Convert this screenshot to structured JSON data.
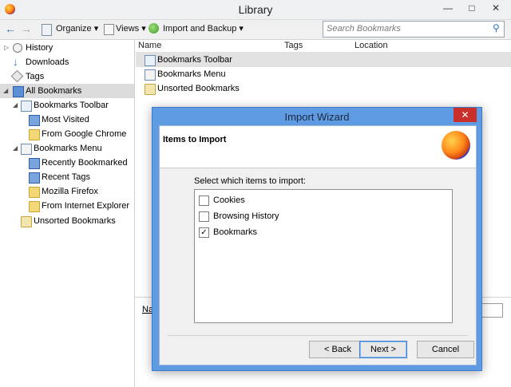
{
  "window": {
    "title": "Library"
  },
  "toolbar": {
    "organize_label": "Organize",
    "views_label": "Views",
    "import_label": "Import and Backup",
    "search_placeholder": "Search Bookmarks"
  },
  "sidebar": {
    "items": [
      {
        "label": "History"
      },
      {
        "label": "Downloads"
      },
      {
        "label": "Tags"
      },
      {
        "label": "All Bookmarks"
      },
      {
        "label": "Bookmarks Toolbar"
      },
      {
        "label": "Most Visited"
      },
      {
        "label": "From Google Chrome"
      },
      {
        "label": "Bookmarks Menu"
      },
      {
        "label": "Recently Bookmarked"
      },
      {
        "label": "Recent Tags"
      },
      {
        "label": "Mozilla Firefox"
      },
      {
        "label": "From Internet Explorer"
      },
      {
        "label": "Unsorted Bookmarks"
      }
    ]
  },
  "content": {
    "columns": [
      "Name",
      "Tags",
      "Location"
    ],
    "rows": [
      {
        "name": "Bookmarks Toolbar"
      },
      {
        "name": "Bookmarks Menu"
      },
      {
        "name": "Unsorted Bookmarks"
      }
    ],
    "name_field_label": "Na"
  },
  "dialog": {
    "title": "Import Wizard",
    "close_label": "✕",
    "heading": "Items to Import",
    "prompt": "Select which items to import:",
    "items": [
      {
        "label": "Cookies",
        "checked": false,
        "mark": ""
      },
      {
        "label": "Browsing History",
        "checked": false,
        "mark": ""
      },
      {
        "label": "Bookmarks",
        "checked": true,
        "mark": "✓"
      }
    ],
    "back_label": "< Back",
    "next_label": "Next >",
    "cancel_label": "Cancel"
  }
}
